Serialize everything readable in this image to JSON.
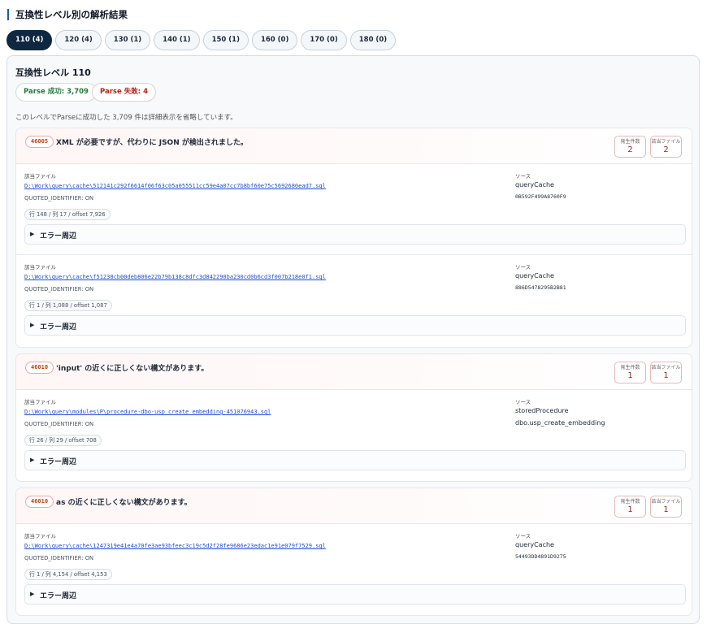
{
  "page": {
    "title": "互換性レベル別の解析結果"
  },
  "tabs": [
    {
      "label": "110 (4)"
    },
    {
      "label": "120 (4)"
    },
    {
      "label": "130 (1)"
    },
    {
      "label": "140 (1)"
    },
    {
      "label": "150 (1)"
    },
    {
      "label": "160 (0)"
    },
    {
      "label": "170 (0)"
    },
    {
      "label": "180 (0)"
    }
  ],
  "level": {
    "title": "互換性レベル 110",
    "parse_ok": "Parse 成功: 3,709",
    "parse_fail": "Parse 失敗: 4",
    "note": "このレベルでParseに成功した 3,709 件は詳細表示を省略しています。"
  },
  "labels": {
    "file": "該当ファイル",
    "source": "ソース",
    "occurrences": "発生件数",
    "files": "該当ファイル",
    "context": "エラー周辺",
    "context_arrow": "▶"
  },
  "errors": [
    {
      "code": "46005",
      "message": "XML が必要ですが、代わりに JSON が検出されました。",
      "count": "2",
      "files": "2",
      "items": [
        {
          "path": "D:\\Work\\query\\cache\\512141c292f6614f06f63c05a055511cc59e4a07cc7b8bf60e75c5692680ead7.sql",
          "quoted": "QUOTED_IDENTIFIER: ON",
          "position": "行 148 / 列 17 / offset 7,926",
          "source_type": "queryCache",
          "source_id": "0B592F499A8760F9"
        },
        {
          "path": "D:\\Work\\query\\cache\\f51238cb00deb806e22b79b138c8dfc3d842290ba230cd0b6cd3f007b218e0f1.sql",
          "quoted": "QUOTED_IDENTIFIER: ON",
          "position": "行 1 / 列 1,088 / offset 1,087",
          "source_type": "queryCache",
          "source_id": "886D5478295B2B81"
        }
      ]
    },
    {
      "code": "46010",
      "message": "'input' の近くに正しくない構文があります。",
      "count": "1",
      "files": "1",
      "items": [
        {
          "path": "D:\\Work\\query\\modules\\P\\procedure-dbo-usp_create_embedding-451076943.sql",
          "quoted": "QUOTED_IDENTIFIER: ON",
          "position": "行 26 / 列 29 / offset 708",
          "source_type": "storedProcedure",
          "source_id": "dbo.usp_create_embedding"
        }
      ]
    },
    {
      "code": "46010",
      "message": "as の近くに正しくない構文があります。",
      "count": "1",
      "files": "1",
      "items": [
        {
          "path": "D:\\Work\\query\\cache\\1247319e41e4a70fe3ae93bfeec3c19c5d2f28fe9686e23edac1e91e079f7529.sql",
          "quoted": "QUOTED_IDENTIFIER: ON",
          "position": "行 1 / 列 4,154 / offset 4,153",
          "source_type": "queryCache",
          "source_id": "54493DD4891D9275"
        }
      ]
    }
  ]
}
